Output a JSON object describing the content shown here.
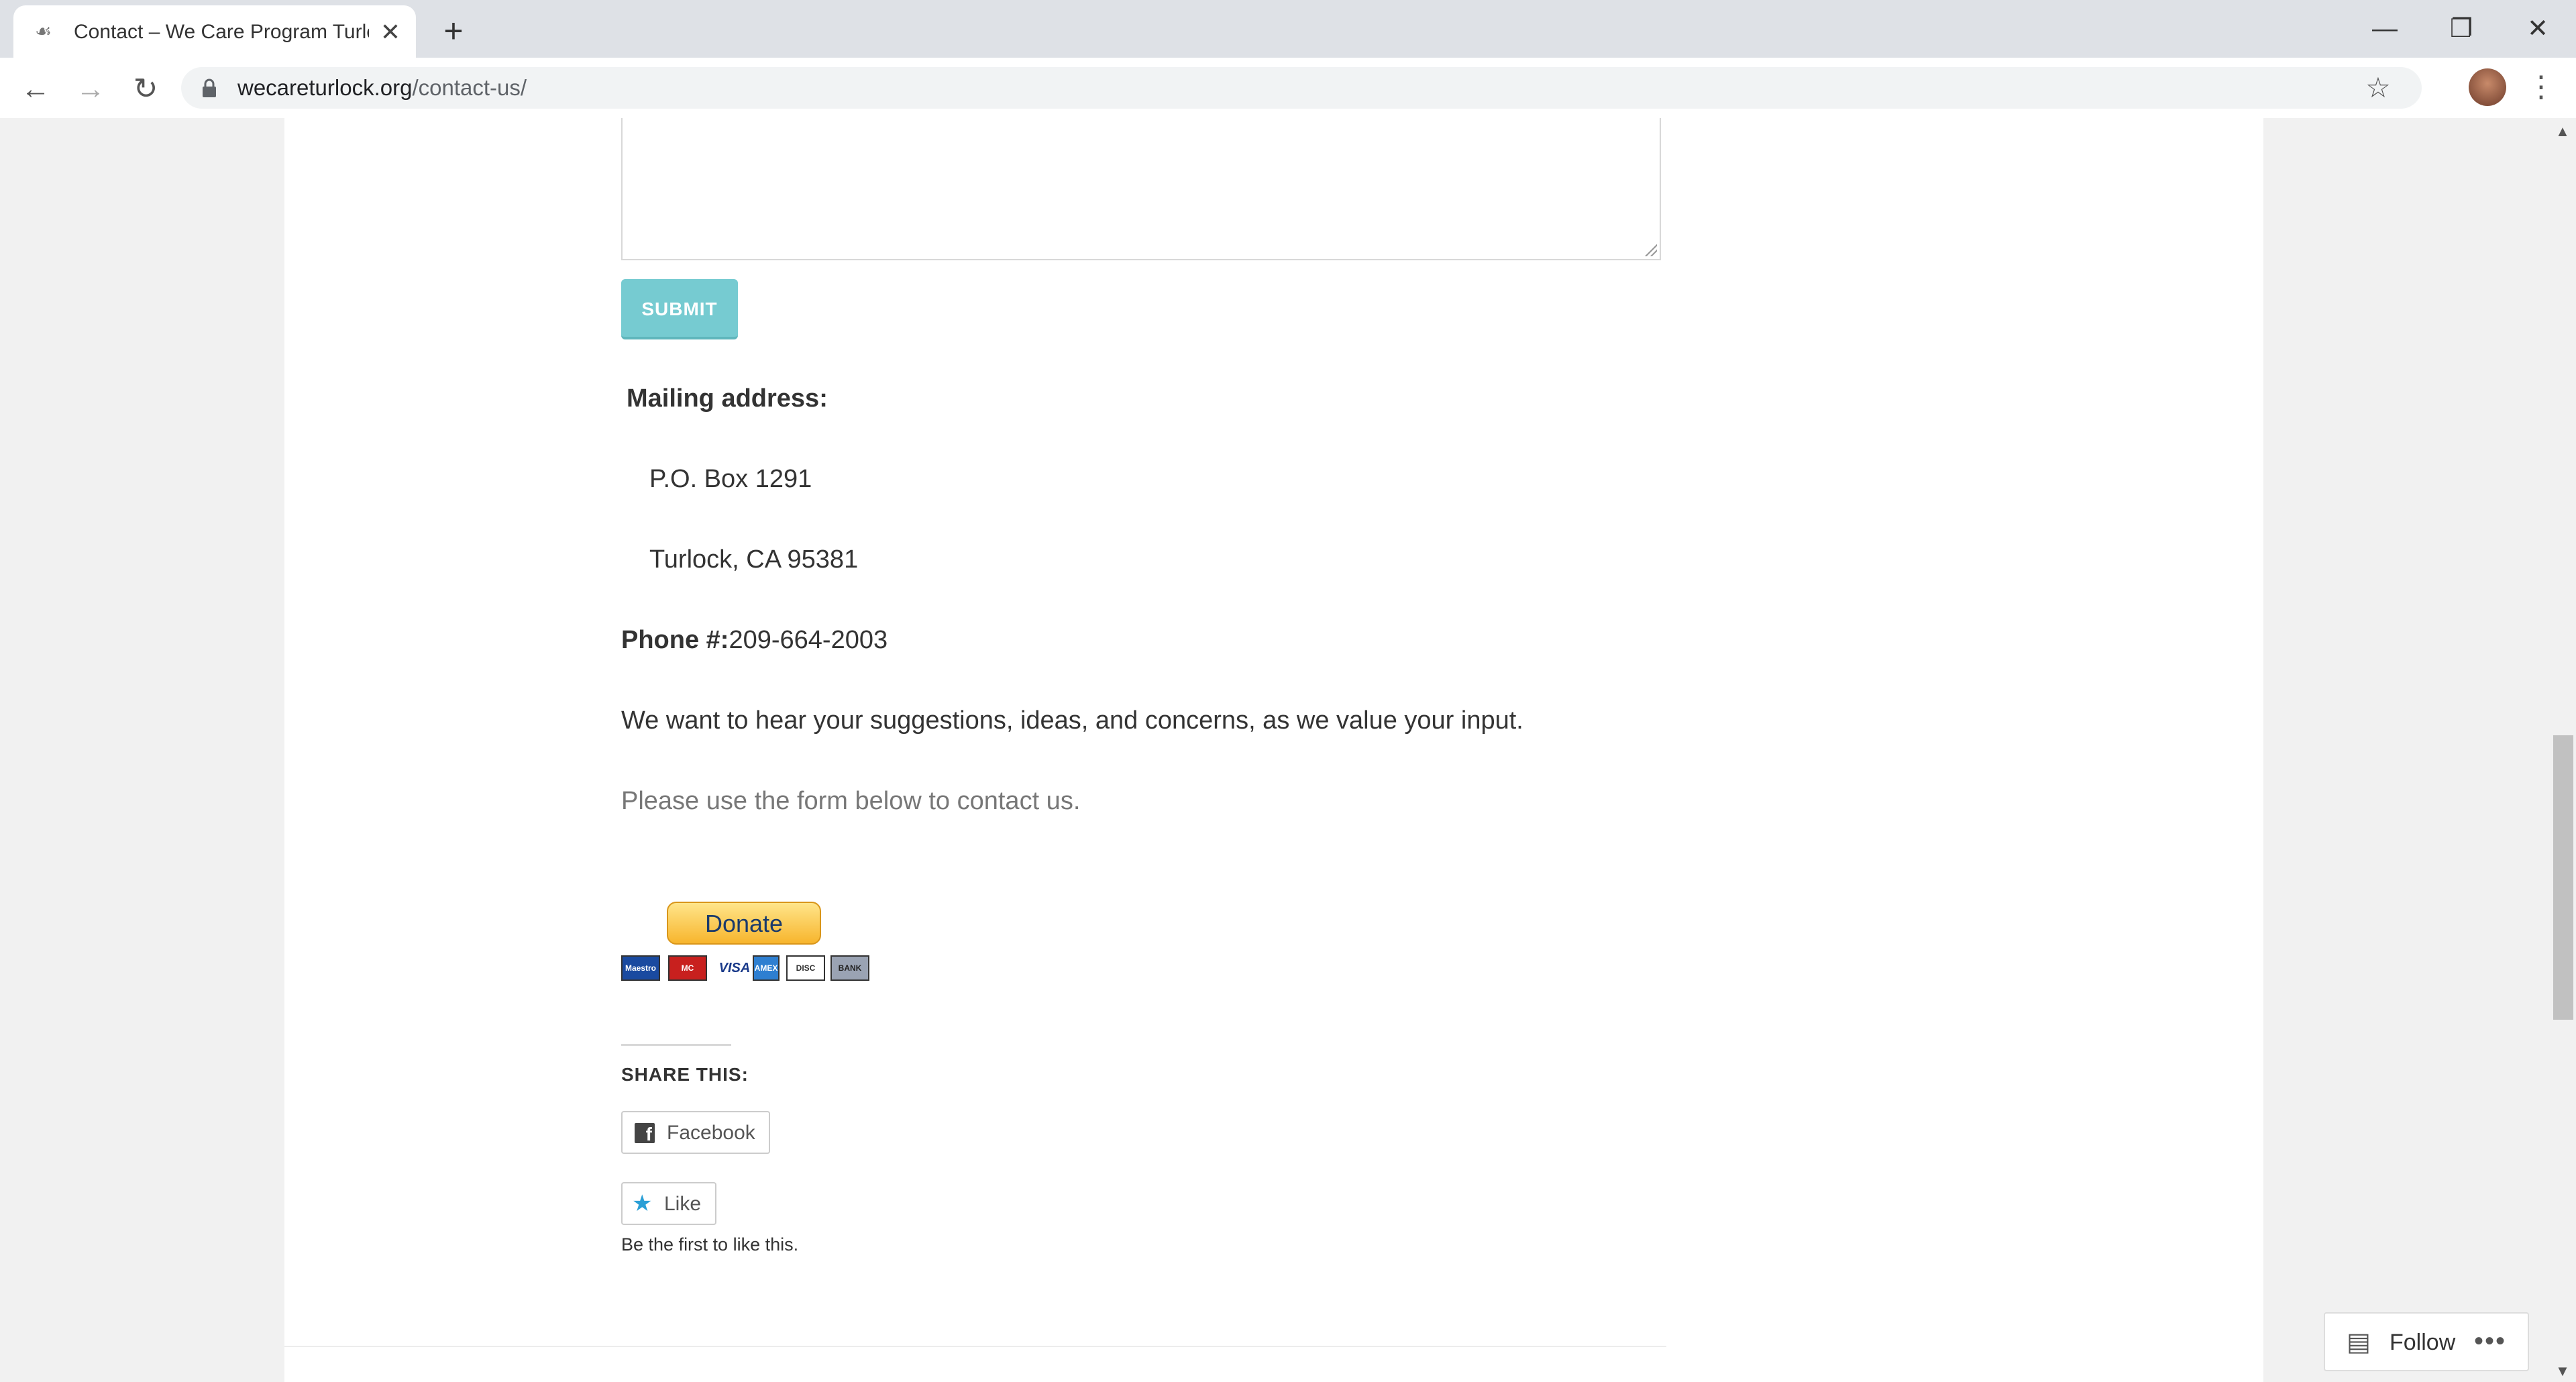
{
  "browser": {
    "tab_title": "Contact – We Care Program Turlo",
    "tab_close": "✕",
    "new_tab": "+",
    "window": {
      "minimize": "—",
      "restore": "❐",
      "close": "✕"
    },
    "nav": {
      "back": "←",
      "forward": "→",
      "reload": "↻"
    },
    "url_host": "wecareturlock.org",
    "url_path": "/contact-us/",
    "star": "☆",
    "menu": "⋮"
  },
  "form": {
    "message_value": "",
    "submit_label": "SUBMIT"
  },
  "contact": {
    "mailing_heading": "Mailing address:",
    "address_line1": "P.O. Box 1291",
    "address_line2": "Turlock, CA 95381",
    "phone_label": "Phone #:",
    "phone_value": "209-664-2003",
    "message": "We want to hear your suggestions, ideas, and concerns, as we value your input.",
    "form_note": "Please use the form below to contact us."
  },
  "donate": {
    "button_label": "Donate",
    "cards": [
      {
        "name": "Maestro",
        "color": "#1a4aa0"
      },
      {
        "name": "MC",
        "color": "#c8201e"
      },
      {
        "name": "VISA",
        "color": "#ffffff"
      },
      {
        "name": "AMEX",
        "color": "#2e7fd1"
      },
      {
        "name": "DISC",
        "color": "#ffffff"
      },
      {
        "name": "BANK",
        "color": "#9aa3b3"
      }
    ]
  },
  "share": {
    "heading": "SHARE THIS:",
    "facebook_label": "Facebook",
    "like_label": "Like",
    "like_note": "Be the first to like this."
  },
  "follow": {
    "label": "Follow",
    "more": "•••"
  },
  "scrollbar": {
    "up": "▲",
    "down": "▼"
  }
}
